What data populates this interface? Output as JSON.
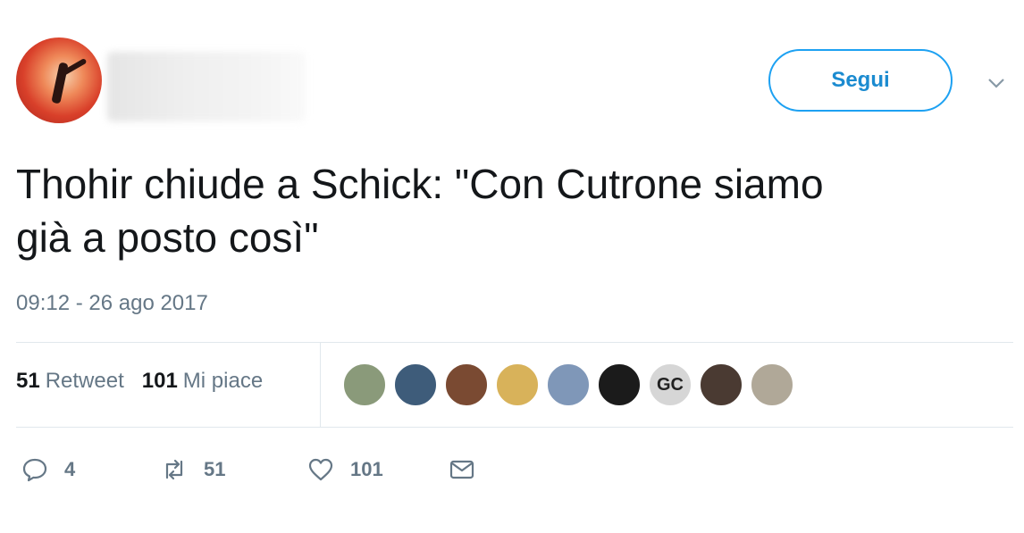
{
  "header": {
    "follow_label": "Segui"
  },
  "tweet": {
    "text_line1": "Thohir chiude a Schick: \"Con Cutrone siamo",
    "text_line2": "già a posto così\"",
    "timestamp": "09:12 - 26 ago 2017"
  },
  "stats": {
    "retweets_count": "51",
    "retweets_label": "Retweet",
    "likes_count": "101",
    "likes_label": "Mi piace"
  },
  "likers": [
    {
      "initials": "",
      "color": "#8a9a7a"
    },
    {
      "initials": "",
      "color": "#3e5c7a"
    },
    {
      "initials": "",
      "color": "#7a4a32"
    },
    {
      "initials": "",
      "color": "#d8b25a"
    },
    {
      "initials": "",
      "color": "#7f97b8"
    },
    {
      "initials": "",
      "color": "#1b1b1b"
    },
    {
      "initials": "GC",
      "color": "#d6d6d6"
    },
    {
      "initials": "",
      "color": "#4a3a32"
    },
    {
      "initials": "",
      "color": "#b0a898"
    }
  ],
  "actions": {
    "replies": "4",
    "retweets": "51",
    "likes": "101"
  },
  "colors": {
    "accent": "#1da1f2",
    "muted": "#657786",
    "text": "#14171a"
  }
}
